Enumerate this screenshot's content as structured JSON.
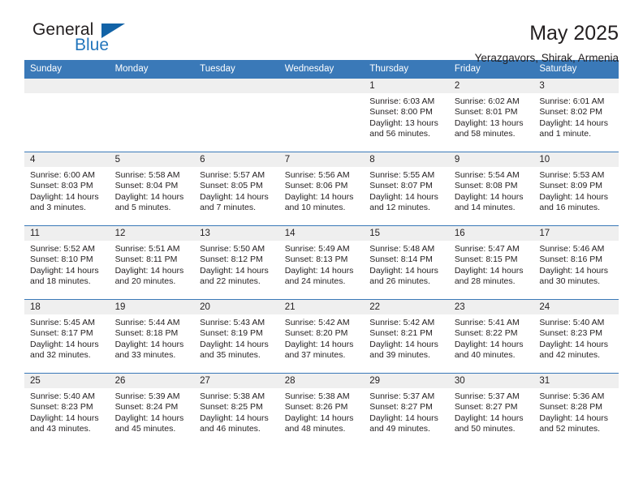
{
  "brand": {
    "name_top": "General",
    "name_bottom": "Blue",
    "accent_color": "#2376bc",
    "triangle_color": "#1263a7"
  },
  "header": {
    "month_title": "May 2025",
    "location": "Yerazgavors, Shirak, Armenia"
  },
  "calendar": {
    "header_color": "#3a79b8",
    "daynum_band_color": "#efefef",
    "weekdays": [
      "Sunday",
      "Monday",
      "Tuesday",
      "Wednesday",
      "Thursday",
      "Friday",
      "Saturday"
    ],
    "weeks": [
      [
        {
          "day": "",
          "empty": true,
          "sunrise": "",
          "sunset": "",
          "daylight1": "",
          "daylight2": ""
        },
        {
          "day": "",
          "empty": true,
          "sunrise": "",
          "sunset": "",
          "daylight1": "",
          "daylight2": ""
        },
        {
          "day": "",
          "empty": true,
          "sunrise": "",
          "sunset": "",
          "daylight1": "",
          "daylight2": ""
        },
        {
          "day": "",
          "empty": true,
          "sunrise": "",
          "sunset": "",
          "daylight1": "",
          "daylight2": ""
        },
        {
          "day": "1",
          "sunrise": "Sunrise: 6:03 AM",
          "sunset": "Sunset: 8:00 PM",
          "daylight1": "Daylight: 13 hours",
          "daylight2": "and 56 minutes."
        },
        {
          "day": "2",
          "sunrise": "Sunrise: 6:02 AM",
          "sunset": "Sunset: 8:01 PM",
          "daylight1": "Daylight: 13 hours",
          "daylight2": "and 58 minutes."
        },
        {
          "day": "3",
          "sunrise": "Sunrise: 6:01 AM",
          "sunset": "Sunset: 8:02 PM",
          "daylight1": "Daylight: 14 hours",
          "daylight2": "and 1 minute."
        }
      ],
      [
        {
          "day": "4",
          "sunrise": "Sunrise: 6:00 AM",
          "sunset": "Sunset: 8:03 PM",
          "daylight1": "Daylight: 14 hours",
          "daylight2": "and 3 minutes."
        },
        {
          "day": "5",
          "sunrise": "Sunrise: 5:58 AM",
          "sunset": "Sunset: 8:04 PM",
          "daylight1": "Daylight: 14 hours",
          "daylight2": "and 5 minutes."
        },
        {
          "day": "6",
          "sunrise": "Sunrise: 5:57 AM",
          "sunset": "Sunset: 8:05 PM",
          "daylight1": "Daylight: 14 hours",
          "daylight2": "and 7 minutes."
        },
        {
          "day": "7",
          "sunrise": "Sunrise: 5:56 AM",
          "sunset": "Sunset: 8:06 PM",
          "daylight1": "Daylight: 14 hours",
          "daylight2": "and 10 minutes."
        },
        {
          "day": "8",
          "sunrise": "Sunrise: 5:55 AM",
          "sunset": "Sunset: 8:07 PM",
          "daylight1": "Daylight: 14 hours",
          "daylight2": "and 12 minutes."
        },
        {
          "day": "9",
          "sunrise": "Sunrise: 5:54 AM",
          "sunset": "Sunset: 8:08 PM",
          "daylight1": "Daylight: 14 hours",
          "daylight2": "and 14 minutes."
        },
        {
          "day": "10",
          "sunrise": "Sunrise: 5:53 AM",
          "sunset": "Sunset: 8:09 PM",
          "daylight1": "Daylight: 14 hours",
          "daylight2": "and 16 minutes."
        }
      ],
      [
        {
          "day": "11",
          "sunrise": "Sunrise: 5:52 AM",
          "sunset": "Sunset: 8:10 PM",
          "daylight1": "Daylight: 14 hours",
          "daylight2": "and 18 minutes."
        },
        {
          "day": "12",
          "sunrise": "Sunrise: 5:51 AM",
          "sunset": "Sunset: 8:11 PM",
          "daylight1": "Daylight: 14 hours",
          "daylight2": "and 20 minutes."
        },
        {
          "day": "13",
          "sunrise": "Sunrise: 5:50 AM",
          "sunset": "Sunset: 8:12 PM",
          "daylight1": "Daylight: 14 hours",
          "daylight2": "and 22 minutes."
        },
        {
          "day": "14",
          "sunrise": "Sunrise: 5:49 AM",
          "sunset": "Sunset: 8:13 PM",
          "daylight1": "Daylight: 14 hours",
          "daylight2": "and 24 minutes."
        },
        {
          "day": "15",
          "sunrise": "Sunrise: 5:48 AM",
          "sunset": "Sunset: 8:14 PM",
          "daylight1": "Daylight: 14 hours",
          "daylight2": "and 26 minutes."
        },
        {
          "day": "16",
          "sunrise": "Sunrise: 5:47 AM",
          "sunset": "Sunset: 8:15 PM",
          "daylight1": "Daylight: 14 hours",
          "daylight2": "and 28 minutes."
        },
        {
          "day": "17",
          "sunrise": "Sunrise: 5:46 AM",
          "sunset": "Sunset: 8:16 PM",
          "daylight1": "Daylight: 14 hours",
          "daylight2": "and 30 minutes."
        }
      ],
      [
        {
          "day": "18",
          "sunrise": "Sunrise: 5:45 AM",
          "sunset": "Sunset: 8:17 PM",
          "daylight1": "Daylight: 14 hours",
          "daylight2": "and 32 minutes."
        },
        {
          "day": "19",
          "sunrise": "Sunrise: 5:44 AM",
          "sunset": "Sunset: 8:18 PM",
          "daylight1": "Daylight: 14 hours",
          "daylight2": "and 33 minutes."
        },
        {
          "day": "20",
          "sunrise": "Sunrise: 5:43 AM",
          "sunset": "Sunset: 8:19 PM",
          "daylight1": "Daylight: 14 hours",
          "daylight2": "and 35 minutes."
        },
        {
          "day": "21",
          "sunrise": "Sunrise: 5:42 AM",
          "sunset": "Sunset: 8:20 PM",
          "daylight1": "Daylight: 14 hours",
          "daylight2": "and 37 minutes."
        },
        {
          "day": "22",
          "sunrise": "Sunrise: 5:42 AM",
          "sunset": "Sunset: 8:21 PM",
          "daylight1": "Daylight: 14 hours",
          "daylight2": "and 39 minutes."
        },
        {
          "day": "23",
          "sunrise": "Sunrise: 5:41 AM",
          "sunset": "Sunset: 8:22 PM",
          "daylight1": "Daylight: 14 hours",
          "daylight2": "and 40 minutes."
        },
        {
          "day": "24",
          "sunrise": "Sunrise: 5:40 AM",
          "sunset": "Sunset: 8:23 PM",
          "daylight1": "Daylight: 14 hours",
          "daylight2": "and 42 minutes."
        }
      ],
      [
        {
          "day": "25",
          "sunrise": "Sunrise: 5:40 AM",
          "sunset": "Sunset: 8:23 PM",
          "daylight1": "Daylight: 14 hours",
          "daylight2": "and 43 minutes."
        },
        {
          "day": "26",
          "sunrise": "Sunrise: 5:39 AM",
          "sunset": "Sunset: 8:24 PM",
          "daylight1": "Daylight: 14 hours",
          "daylight2": "and 45 minutes."
        },
        {
          "day": "27",
          "sunrise": "Sunrise: 5:38 AM",
          "sunset": "Sunset: 8:25 PM",
          "daylight1": "Daylight: 14 hours",
          "daylight2": "and 46 minutes."
        },
        {
          "day": "28",
          "sunrise": "Sunrise: 5:38 AM",
          "sunset": "Sunset: 8:26 PM",
          "daylight1": "Daylight: 14 hours",
          "daylight2": "and 48 minutes."
        },
        {
          "day": "29",
          "sunrise": "Sunrise: 5:37 AM",
          "sunset": "Sunset: 8:27 PM",
          "daylight1": "Daylight: 14 hours",
          "daylight2": "and 49 minutes."
        },
        {
          "day": "30",
          "sunrise": "Sunrise: 5:37 AM",
          "sunset": "Sunset: 8:27 PM",
          "daylight1": "Daylight: 14 hours",
          "daylight2": "and 50 minutes."
        },
        {
          "day": "31",
          "sunrise": "Sunrise: 5:36 AM",
          "sunset": "Sunset: 8:28 PM",
          "daylight1": "Daylight: 14 hours",
          "daylight2": "and 52 minutes."
        }
      ]
    ]
  }
}
